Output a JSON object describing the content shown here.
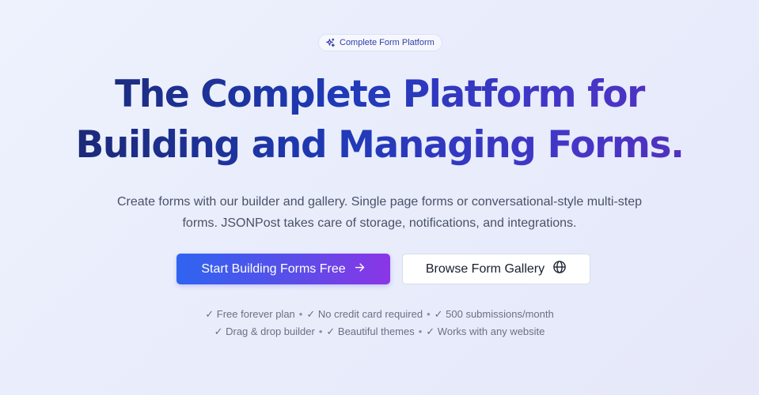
{
  "badge": {
    "icon": "sparkles-icon",
    "label": "Complete Form Platform"
  },
  "headline": {
    "line1": "The Complete Platform for",
    "line2": "Building and Managing Forms."
  },
  "subtitle": {
    "line1": "Create forms with our builder and gallery. Single page forms or conversational-style multi-step",
    "line2": "forms. JSONPost takes care of storage, notifications, and integrations."
  },
  "cta": {
    "primary_label": "Start Building Forms Free",
    "primary_icon": "arrow-right-icon",
    "secondary_label": "Browse Form Gallery",
    "secondary_icon": "globe-icon"
  },
  "features": {
    "separator": "•",
    "row1": [
      "✓ Free forever plan",
      "✓ No credit card required",
      "✓ 500 submissions/month"
    ],
    "row2": [
      "✓ Drag & drop builder",
      "✓ Beautiful themes",
      "✓ Works with any website"
    ]
  },
  "colors": {
    "accent_start": "#2f64f0",
    "accent_end": "#8b35e6",
    "heading_dark": "#1b2565",
    "background": "#eef2fd"
  }
}
